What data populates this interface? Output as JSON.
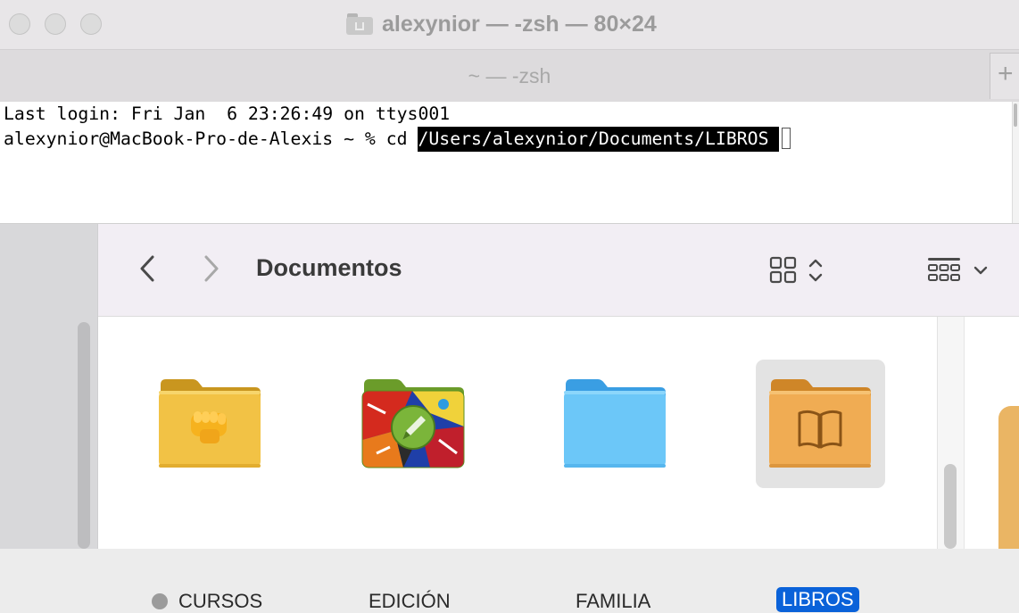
{
  "terminal": {
    "window_title": "alexynior — -zsh — 80×24",
    "tab_title": "~ — -zsh",
    "new_tab_symbol": "+",
    "lines": [
      {
        "text": "Last login: Fri Jan  6 23:26:49 on ttys001"
      },
      {
        "prompt": "alexynior@MacBook-Pro-de-Alexis ~ % cd ",
        "selected": "/Users/alexynior/Documents/LIBROS "
      }
    ]
  },
  "finder": {
    "title": "Documentos",
    "items": [
      {
        "label": "CURSOS",
        "icon": "fist-folder-icon",
        "tag_color": "#9b9b9b",
        "color": "#f2c245"
      },
      {
        "label": "EDICIÓN",
        "icon": "painted-folder-icon",
        "color": "#7bb53a"
      },
      {
        "label": "FAMILIA",
        "icon": "folder-icon",
        "color": "#6cc7f8"
      },
      {
        "label": "LIBROS",
        "icon": "book-folder-icon",
        "color": "#f0ac53",
        "selected": true
      }
    ]
  }
}
